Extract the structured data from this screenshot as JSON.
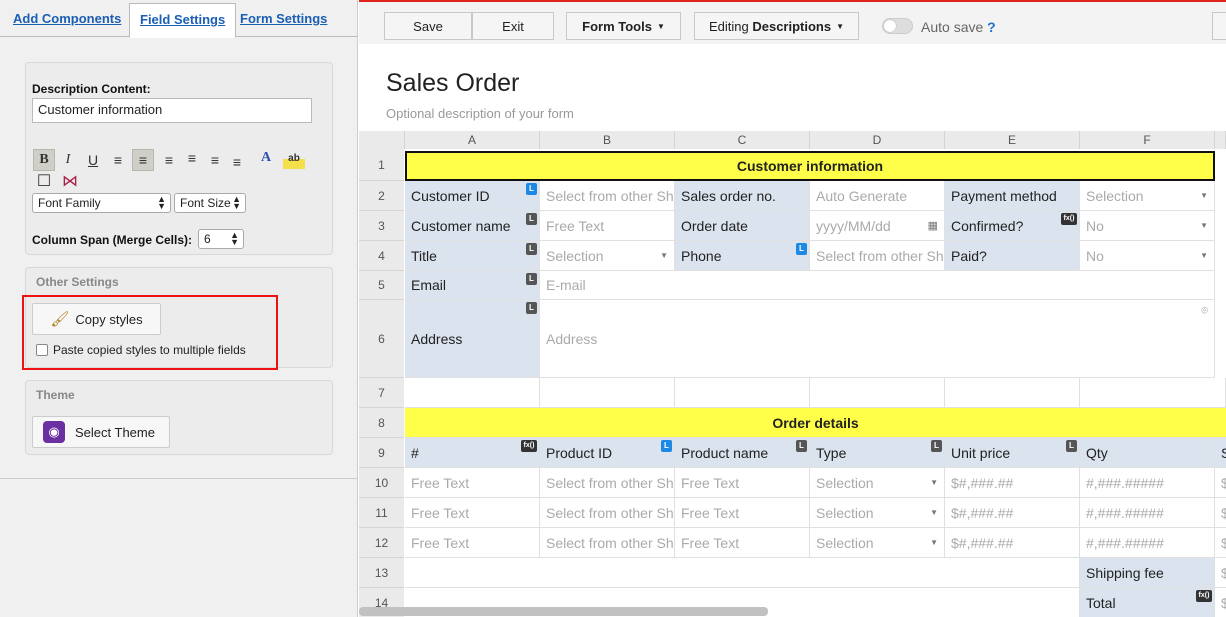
{
  "tabs": [
    {
      "label": "Add Components"
    },
    {
      "label": "Field Settings"
    },
    {
      "label": "Form Settings"
    }
  ],
  "description": {
    "heading": "Description Content:",
    "value": "Customer information",
    "font_family": "Font Family",
    "font_size": "Font Size",
    "span_label": "Column Span (Merge Cells):",
    "span_value": "6"
  },
  "format_buttons": [
    {
      "icon": "bold-icon",
      "glyph": "B"
    },
    {
      "icon": "italic-icon",
      "glyph": "I"
    },
    {
      "icon": "underline-icon",
      "glyph": "U"
    },
    {
      "icon": "align-left-icon",
      "glyph": "≡"
    },
    {
      "icon": "align-center-icon",
      "glyph": "≡"
    },
    {
      "icon": "align-right-icon",
      "glyph": "≡"
    },
    {
      "icon": "align-top-icon",
      "glyph": "≡"
    },
    {
      "icon": "align-middle-icon",
      "glyph": "≡"
    },
    {
      "icon": "align-bottom-icon",
      "glyph": "≡"
    },
    {
      "icon": "font-color-icon",
      "glyph": "A"
    },
    {
      "icon": "highlight-icon",
      "glyph": "ab"
    },
    {
      "icon": "border-icon",
      "glyph": "☐"
    },
    {
      "icon": "merge-icon",
      "glyph": "⋈"
    }
  ],
  "other": {
    "title": "Other Settings",
    "copy_label": "Copy styles",
    "paste_label": "Paste copied styles to multiple fields"
  },
  "theme": {
    "title": "Theme",
    "select_label": "Select Theme"
  },
  "toolbar": {
    "save": "Save",
    "exit": "Exit",
    "form_tools": "Form Tools",
    "editing_prefix": "Editing ",
    "editing_mode": "Descriptions",
    "autosave": "Auto save",
    "help": "?"
  },
  "form": {
    "title": "Sales Order",
    "description": "Optional description of your form"
  },
  "columns": [
    "A",
    "B",
    "C",
    "D",
    "E",
    "F"
  ],
  "rows": [
    "1",
    "2",
    "3",
    "4",
    "5",
    "6",
    "7",
    "8",
    "9",
    "10",
    "11",
    "12",
    "13",
    "14"
  ],
  "cells": {
    "r1": "Customer information",
    "r2": [
      "Customer ID",
      "Select from other Sheet",
      "Sales order no.",
      "Auto Generate",
      "Payment method",
      "Selection"
    ],
    "r3": [
      "Customer name",
      "Free Text",
      "Order date",
      "yyyy/MM/dd",
      "Confirmed?",
      "No"
    ],
    "r4": [
      "Title",
      "Selection",
      "Phone",
      "Select from other Sheet",
      "Paid?",
      "No"
    ],
    "r5": [
      "Email",
      "E-mail"
    ],
    "r6": [
      "Address",
      "Address"
    ],
    "r8": "Order details",
    "r9": [
      "#",
      "Product ID",
      "Product name",
      "Type",
      "Unit price",
      "Qty",
      "S"
    ],
    "item_row": [
      "Free Text",
      "Select from other Sheet",
      "Free Text",
      "Selection",
      "$#,###.##",
      "#,###.#####",
      "$"
    ],
    "r13": [
      "Shipping fee",
      "$"
    ],
    "r14": [
      "Total",
      "$"
    ]
  },
  "badges": {
    "lookup": "L",
    "formula": "fx()"
  }
}
